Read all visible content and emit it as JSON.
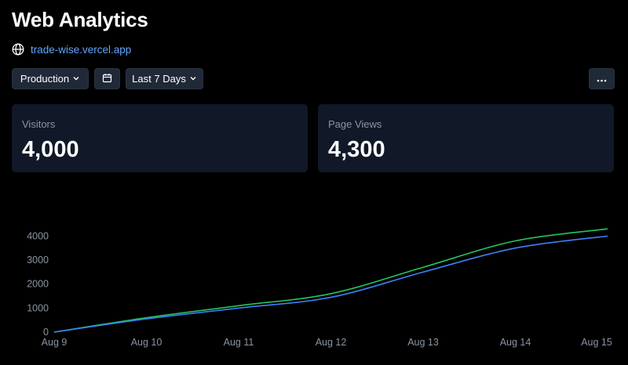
{
  "header": {
    "title": "Web Analytics",
    "site_icon": "globe-icon",
    "site_url": "trade-wise.vercel.app"
  },
  "toolbar": {
    "environment_label": "Production",
    "calendar_icon": "calendar-icon",
    "range_label": "Last 7 Days",
    "more_icon": "more-horizontal-icon"
  },
  "stats": {
    "visitors_label": "Visitors",
    "visitors_value": "4,000",
    "page_views_label": "Page Views",
    "page_views_value": "4,300"
  },
  "colors": {
    "background": "#000000",
    "card": "#111827",
    "button": "#1f2937",
    "link": "#60a5fa",
    "visitors_line": "#3b82f6",
    "page_views_line": "#22c55e",
    "muted_text": "#8b95a5"
  },
  "chart_data": {
    "type": "line",
    "x": [
      "Aug 9",
      "Aug 10",
      "Aug 11",
      "Aug 12",
      "Aug 13",
      "Aug 14",
      "Aug 15"
    ],
    "series": [
      {
        "key": "page_views",
        "values": [
          0,
          600,
          1100,
          1600,
          2700,
          3800,
          4300
        ]
      },
      {
        "key": "visitors",
        "values": [
          0,
          550,
          1000,
          1450,
          2500,
          3500,
          4000
        ]
      }
    ],
    "yticks": [
      0,
      1000,
      2000,
      3000,
      4000
    ],
    "ylim": [
      0,
      4600
    ],
    "grid": false,
    "legend": "none"
  }
}
